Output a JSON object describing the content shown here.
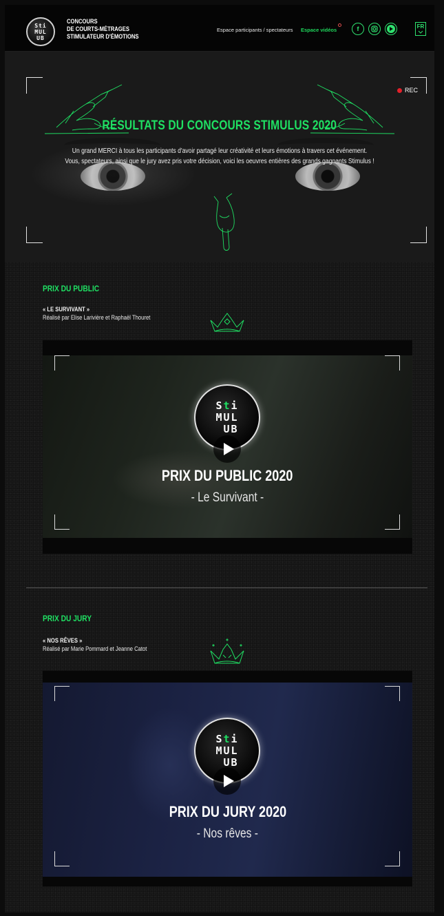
{
  "header": {
    "logo": [
      "Sti",
      "MUL",
      "UB"
    ],
    "brand_lines": [
      "CONCOURS",
      "DE COURTS-MÉTRAGES",
      "STIMULATEUR D'ÉMOTIONS"
    ],
    "nav": {
      "participants": "Espace participants / spectateurs",
      "videos": "Espace vidéos"
    },
    "social": [
      "facebook-icon",
      "instagram-icon",
      "youtube-icon"
    ],
    "lang": "FR"
  },
  "hero": {
    "rec": "REC",
    "title": "RÉSULTATS DU CONCOURS STIMULUS 2020",
    "text_line1": "Un grand MERCI à tous les participants d'avoir partagé leur créativité et leurs émotions à travers cet événement.",
    "text_line2": "Vous, spectateurs, ainsi que le jury avez pris votre décision, voici les oeuvres entières des grands gagnants Stimulus !"
  },
  "sections": [
    {
      "heading": "PRIX DU PUBLIC",
      "film_title": "« LE SURVIVANT »",
      "credit": "Réalisé par Elise Larivière et Raphaël Thouret",
      "video_title": "PRIX DU PUBLIC 2020",
      "video_subtitle": "- Le Survivant -"
    },
    {
      "heading": "PRIX DU JURY",
      "film_title": "« NOS RÊVES »",
      "credit": "Réalisé par Marie Pommard et Jeanne Catot",
      "video_title": "PRIX DU JURY 2020",
      "video_subtitle": "- Nos rêves -"
    }
  ],
  "colors": {
    "accent": "#1fe063",
    "rec": "#e3202a",
    "background": "#141414"
  }
}
